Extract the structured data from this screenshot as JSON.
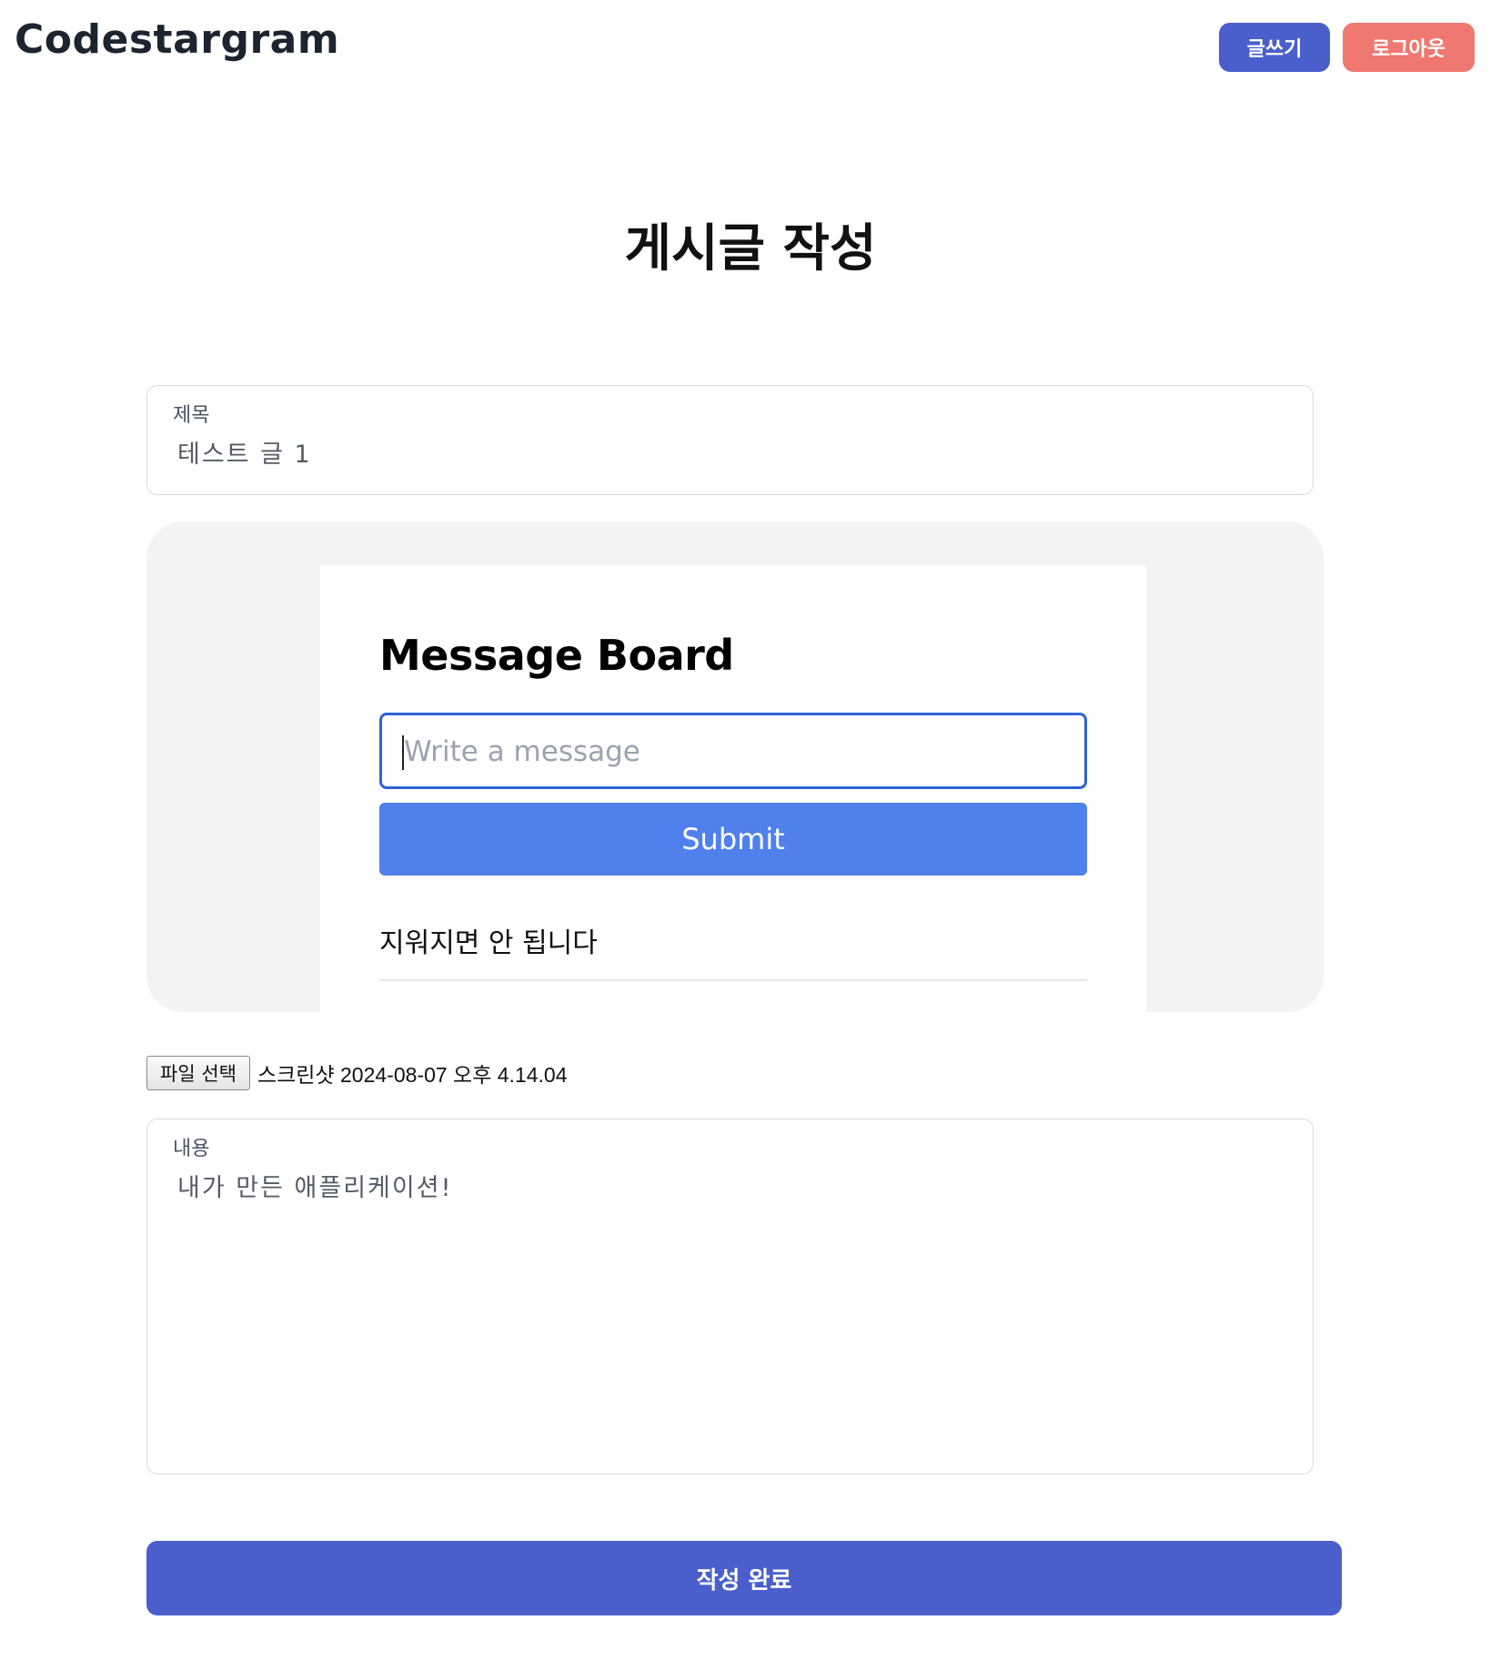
{
  "header": {
    "logo": "Codestargram",
    "write_label": "글쓰기",
    "logout_label": "로그아웃"
  },
  "page_title": "게시글 작성",
  "title_field": {
    "label": "제목",
    "value": "테스트 글 1"
  },
  "preview": {
    "card_title": "Message Board",
    "input_placeholder": "Write a message",
    "submit_label": "Submit",
    "message": "지워지면 안 됩니다"
  },
  "file": {
    "button_label": "파일 선택",
    "file_name": "스크린샷 2024-08-07 오후 4.14.04"
  },
  "content_field": {
    "label": "내용",
    "value": "내가 만든 애플리케이션!"
  },
  "submit_label": "작성 완료",
  "colors": {
    "primary": "#4a5fcb",
    "danger": "#ef7870",
    "card_button": "#4f80ec",
    "card_input_border": "#2f63d6"
  }
}
